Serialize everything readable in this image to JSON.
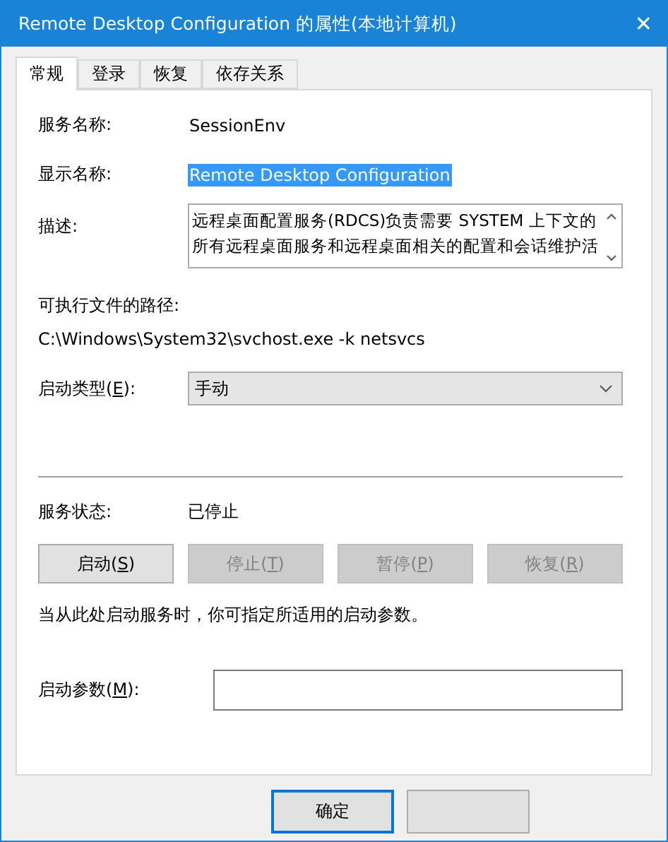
{
  "window": {
    "title": "Remote Desktop Configuration 的属性(本地计算机)",
    "close": "✕"
  },
  "tabs": [
    {
      "label": "常规",
      "selected": true
    },
    {
      "label": "登录",
      "selected": false
    },
    {
      "label": "恢复",
      "selected": false
    },
    {
      "label": "依存关系",
      "selected": false
    }
  ],
  "service_name": {
    "label": "服务名称:",
    "value": "SessionEnv"
  },
  "display_name": {
    "label": "显示名称:",
    "value": "Remote Desktop Configuration",
    "selected": true
  },
  "description": {
    "label": "描述:",
    "value": "远程桌面配置服务(RDCS)负责需要 SYSTEM 上下文的所有远程桌面服务和远程桌面相关的配置和会话维护活"
  },
  "executable_path": {
    "label": "可执行文件的路径:",
    "value": "C:\\Windows\\System32\\svchost.exe -k netsvcs"
  },
  "startup_type": {
    "label": {
      "before": "启动类型(",
      "key": "E",
      "after": "):"
    },
    "value": "手动"
  },
  "service_status": {
    "label": "服务状态:",
    "value": "已停止"
  },
  "service_buttons": [
    {
      "before": "启动(",
      "key": "S",
      "after": ")",
      "disabled": false
    },
    {
      "before": "停止(",
      "key": "T",
      "after": ")",
      "disabled": true
    },
    {
      "before": "暂停(",
      "key": "P",
      "after": ")",
      "disabled": true
    },
    {
      "before": "恢复(",
      "key": "R",
      "after": ")",
      "disabled": true
    }
  ],
  "hint": "当从此处启动服务时，你可指定所适用的启动参数。",
  "start_parameters": {
    "label": {
      "before": "启动参数(",
      "key": "M",
      "after": "):"
    }
  },
  "dialog_buttons": [
    {
      "label": "确定",
      "default": true
    },
    {
      "default": false
    }
  ]
}
